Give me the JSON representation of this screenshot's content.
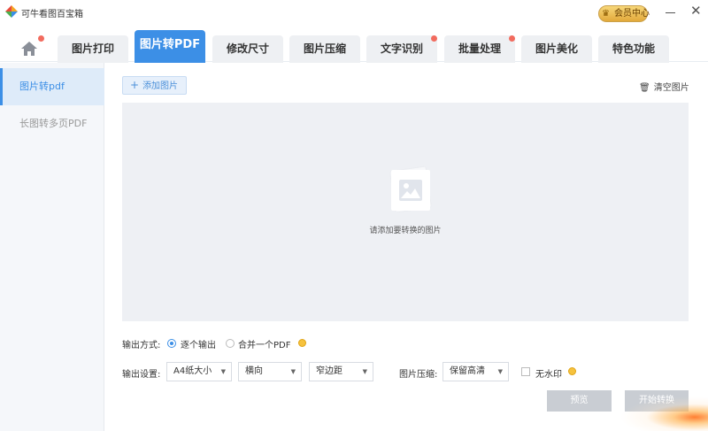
{
  "app": {
    "title": "可牛看图百宝箱"
  },
  "vip": {
    "label": "会员中心"
  },
  "tabs": [
    {
      "label": "图片打印"
    },
    {
      "label": "图片转PDF"
    },
    {
      "label": "修改尺寸"
    },
    {
      "label": "图片压缩"
    },
    {
      "label": "文字识别"
    },
    {
      "label": "批量处理"
    },
    {
      "label": "图片美化"
    },
    {
      "label": "特色功能"
    }
  ],
  "active_tab": "图片转PDF",
  "sidebar": {
    "items": [
      {
        "label": "图片转pdf",
        "active": true
      },
      {
        "label": "长图转多页PDF",
        "active": false
      }
    ]
  },
  "toolbar": {
    "add_label": "添加图片",
    "clear_label": "清空图片"
  },
  "dropzone": {
    "hint": "请添加要转换的图片"
  },
  "output_mode": {
    "label": "输出方式:",
    "options": [
      {
        "label": "逐个输出",
        "selected": true
      },
      {
        "label": "合并一个PDF",
        "selected": false
      }
    ]
  },
  "output_settings": {
    "label": "输出设置:",
    "paper": "A4纸大小",
    "orientation": "横向",
    "margin": "窄边距"
  },
  "compression": {
    "label": "图片压缩:",
    "value": "保留高清"
  },
  "watermark": {
    "label": "无水印",
    "checked": false
  },
  "actions": {
    "preview_label": "预览",
    "start_label": "开始转换"
  },
  "colors": {
    "accent": "#3c8fe6",
    "notify_dot": "#f26b5e",
    "vip_gold": "#e2a93a",
    "disabled_button": "#c9cdd3"
  }
}
